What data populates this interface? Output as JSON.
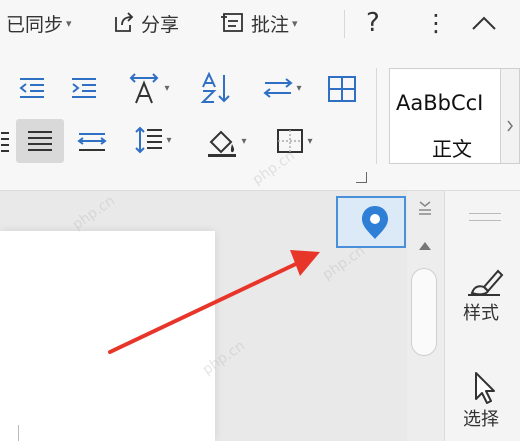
{
  "topbar": {
    "sync_label": "已同步",
    "share_label": "分享",
    "comment_label": "批注",
    "help_symbol": "?",
    "more_symbol": "⋮",
    "collapse_symbol": "^"
  },
  "styles_gallery": {
    "sample_text": "AaBbCcI",
    "style_name": "正文"
  },
  "side_panel": {
    "styles_label": "样式",
    "select_label": "选择"
  },
  "watermark_text": "php.cn",
  "icons": {
    "decrease_indent": "decrease-indent-icon",
    "increase_indent": "increase-indent-icon",
    "text_direction": "text-direction-icon",
    "sort": "sort-icon",
    "line_spacing_toggle": "distribute-icon",
    "table_border": "border-icon",
    "justify": "justify-icon",
    "distributed": "distributed-align-icon",
    "line_spacing": "line-spacing-icon",
    "shading": "shading-icon",
    "borders": "borders-icon",
    "navigation": "location-pin-icon",
    "styles": "brush-icon",
    "select": "cursor-icon"
  },
  "colors": {
    "accent": "#2f6fc4",
    "nav_highlight": "#dce9f6",
    "arrow": "#e8352a"
  }
}
